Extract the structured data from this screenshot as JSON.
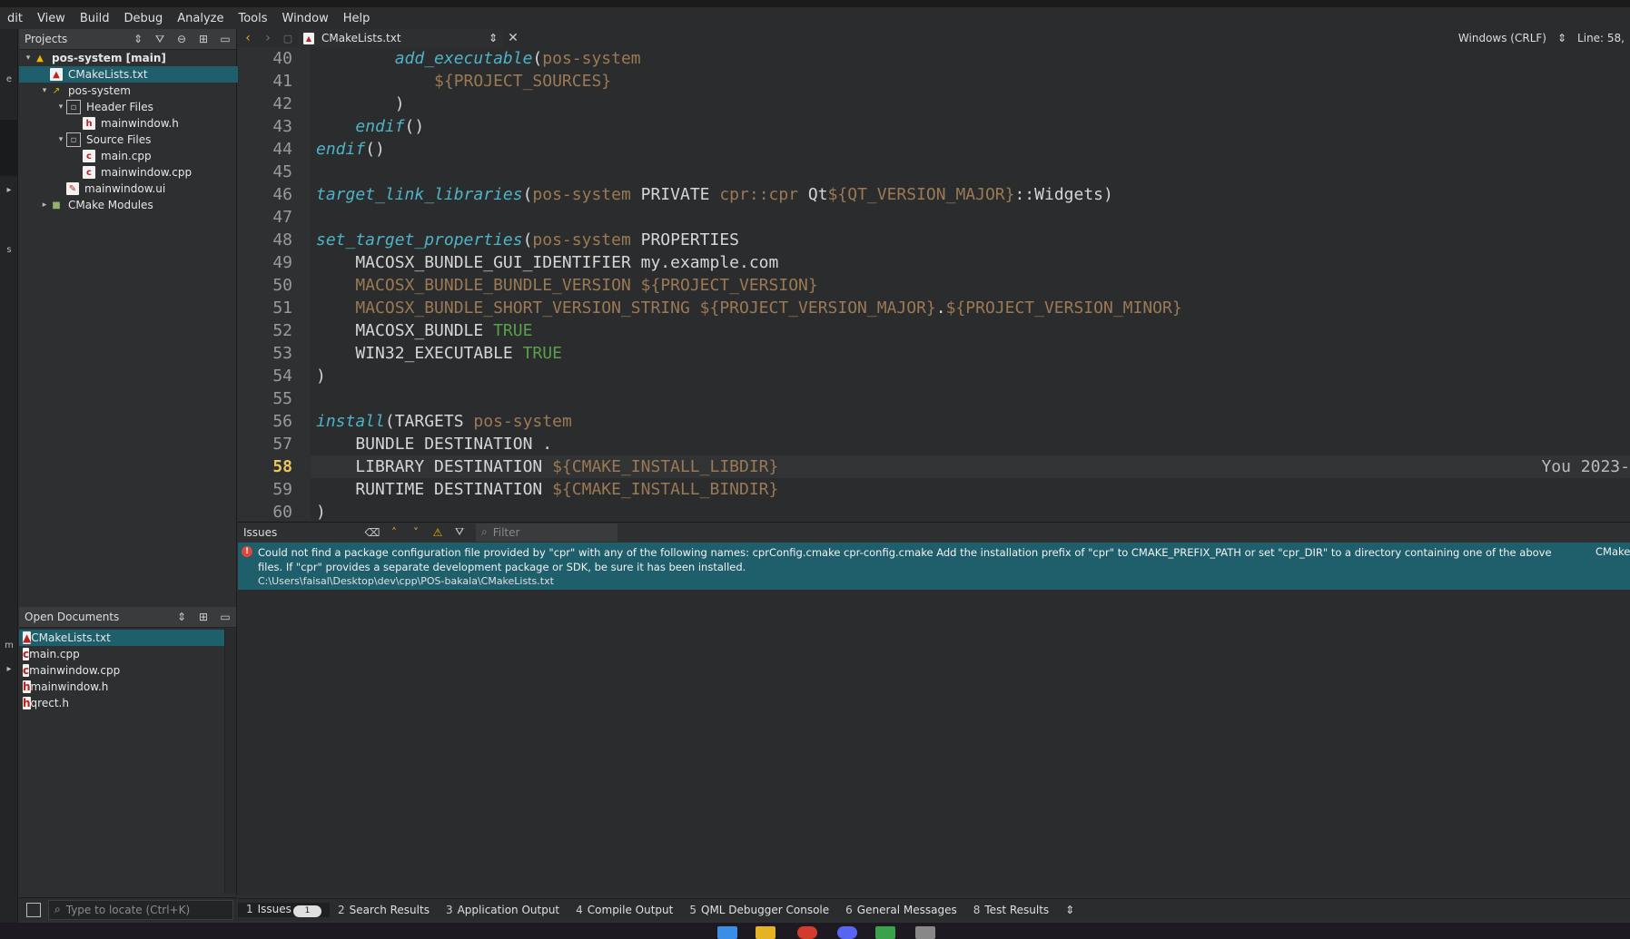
{
  "menu": [
    "dit",
    "View",
    "Build",
    "Debug",
    "Analyze",
    "Tools",
    "Window",
    "Help"
  ],
  "projects_pane": {
    "title": "Projects",
    "tree": [
      {
        "label": "pos-system [main]",
        "indent": 0,
        "arrow": "▾",
        "icon": "warning-icon",
        "bold": true
      },
      {
        "label": "CMakeLists.txt",
        "indent": 1,
        "arrow": "",
        "icon": "cmake-file-icon",
        "selected": true
      },
      {
        "label": "pos-system",
        "indent": 1,
        "arrow": "▾",
        "icon": "target-icon"
      },
      {
        "label": "Header Files",
        "indent": 2,
        "arrow": "▾",
        "icon": "folder-icon"
      },
      {
        "label": "mainwindow.h",
        "indent": 3,
        "arrow": "",
        "icon": "header-file-icon"
      },
      {
        "label": "Source Files",
        "indent": 2,
        "arrow": "▾",
        "icon": "folder-icon"
      },
      {
        "label": "main.cpp",
        "indent": 3,
        "arrow": "",
        "icon": "cpp-file-icon"
      },
      {
        "label": "mainwindow.cpp",
        "indent": 3,
        "arrow": "",
        "icon": "cpp-file-icon"
      },
      {
        "label": "mainwindow.ui",
        "indent": 2,
        "arrow": "",
        "icon": "ui-file-icon"
      },
      {
        "label": "CMake Modules",
        "indent": 1,
        "arrow": "▸",
        "icon": "modules-folder-icon"
      }
    ]
  },
  "open_documents": {
    "title": "Open Documents",
    "items": [
      {
        "label": "CMakeLists.txt",
        "selected": true
      },
      {
        "label": "main.cpp"
      },
      {
        "label": "mainwindow.cpp"
      },
      {
        "label": "mainwindow.h"
      },
      {
        "label": "qrect.h"
      }
    ]
  },
  "locator": {
    "placeholder": "Type to locate (Ctrl+K)"
  },
  "editor": {
    "tab_file": "CMakeLists.txt",
    "line_ending": "Windows (CRLF)",
    "position": "Line: 58,",
    "current_line": 58,
    "blame": "You 2023-",
    "lines": [
      {
        "n": "40",
        "t": [
          [
            "        ",
            ""
          ],
          [
            "add_executable",
            "fn"
          ],
          [
            "(",
            "kw"
          ],
          [
            "pos-system",
            "var"
          ]
        ]
      },
      {
        "n": "41",
        "t": [
          [
            "            ",
            ""
          ],
          [
            "${PROJECT_SOURCES}",
            "var"
          ]
        ]
      },
      {
        "n": "42",
        "t": [
          [
            "        )",
            ""
          ]
        ]
      },
      {
        "n": "43",
        "t": [
          [
            "    ",
            ""
          ],
          [
            "endif",
            "fn"
          ],
          [
            "()",
            ""
          ]
        ]
      },
      {
        "n": "44",
        "t": [
          [
            "endif",
            "fn"
          ],
          [
            "()",
            ""
          ]
        ]
      },
      {
        "n": "45",
        "t": [
          [
            "",
            ""
          ]
        ]
      },
      {
        "n": "46",
        "t": [
          [
            "target_link_libraries",
            "fn"
          ],
          [
            "(",
            ""
          ],
          [
            "pos-system",
            "var"
          ],
          [
            " PRIVATE ",
            ""
          ],
          [
            "cpr::cpr",
            "var"
          ],
          [
            " Qt",
            ""
          ],
          [
            "${QT_VERSION_MAJOR}",
            "var"
          ],
          [
            "::Widgets)",
            ""
          ]
        ]
      },
      {
        "n": "47",
        "t": [
          [
            "",
            ""
          ]
        ]
      },
      {
        "n": "48",
        "t": [
          [
            "set_target_properties",
            "fn"
          ],
          [
            "(",
            ""
          ],
          [
            "pos-system",
            "var"
          ],
          [
            " PROPERTIES",
            ""
          ]
        ]
      },
      {
        "n": "49",
        "t": [
          [
            "    MACOSX_BUNDLE_GUI_IDENTIFIER my.example.com",
            ""
          ]
        ]
      },
      {
        "n": "50",
        "t": [
          [
            "    ",
            ""
          ],
          [
            "MACOSX_BUNDLE_BUNDLE_VERSION ",
            "var"
          ],
          [
            "${PROJECT_VERSION}",
            "var"
          ]
        ]
      },
      {
        "n": "51",
        "t": [
          [
            "    ",
            ""
          ],
          [
            "MACOSX_BUNDLE_SHORT_VERSION_STRING ",
            "var"
          ],
          [
            "${PROJECT_VERSION_MAJOR}",
            "var"
          ],
          [
            ".",
            ""
          ],
          [
            "${PROJECT_VERSION_MINOR}",
            "var"
          ]
        ]
      },
      {
        "n": "52",
        "t": [
          [
            "    MACOSX_BUNDLE ",
            ""
          ],
          [
            "TRUE",
            "bool"
          ]
        ]
      },
      {
        "n": "53",
        "t": [
          [
            "    WIN32_EXECUTABLE ",
            ""
          ],
          [
            "TRUE",
            "bool"
          ]
        ]
      },
      {
        "n": "54",
        "t": [
          [
            ")",
            ""
          ]
        ]
      },
      {
        "n": "55",
        "t": [
          [
            "",
            ""
          ]
        ]
      },
      {
        "n": "56",
        "t": [
          [
            "install",
            "fn"
          ],
          [
            "(TARGETS ",
            ""
          ],
          [
            "pos-system",
            "var"
          ]
        ]
      },
      {
        "n": "57",
        "t": [
          [
            "    BUNDLE DESTINATION .",
            ""
          ]
        ]
      },
      {
        "n": "58",
        "t": [
          [
            "    LIBRARY DESTINATION ",
            ""
          ],
          [
            "${CMAKE_INSTALL_LIBDIR}",
            "var"
          ]
        ]
      },
      {
        "n": "59",
        "t": [
          [
            "    RUNTIME DESTINATION ",
            ""
          ],
          [
            "${CMAKE_INSTALL_BINDIR}",
            "var"
          ]
        ]
      },
      {
        "n": "60",
        "t": [
          [
            ")",
            ""
          ]
        ]
      }
    ]
  },
  "issues": {
    "title": "Issues",
    "filter_placeholder": "Filter",
    "message": "Could not find a package configuration file provided by \"cpr\" with any of the following names: cprConfig.cmake cpr-config.cmake Add the installation prefix of \"cpr\" to CMAKE_PREFIX_PATH or set \"cpr_DIR\" to a directory containing one of the above files.  If \"cpr\" provides a separate development package or SDK, be sure it has been installed.",
    "path": "C:\\Users\\faisal\\Desktop\\dev\\cpp\\POS-bakala\\CMakeLists.txt",
    "category": "CMake"
  },
  "output_tabs": [
    {
      "num": "1",
      "label": "Issues",
      "badge": "1"
    },
    {
      "num": "2",
      "label": "Search Results"
    },
    {
      "num": "3",
      "label": "Application Output"
    },
    {
      "num": "4",
      "label": "Compile Output"
    },
    {
      "num": "5",
      "label": "QML Debugger Console"
    },
    {
      "num": "6",
      "label": "General Messages"
    },
    {
      "num": "8",
      "label": "Test Results"
    }
  ],
  "colors": {
    "accent_selection": "#1f5f6c",
    "function": "#4fb3c6",
    "variable": "#9b7a53",
    "boolean": "#5aa04a",
    "current_line_number": "#e8c85c"
  }
}
